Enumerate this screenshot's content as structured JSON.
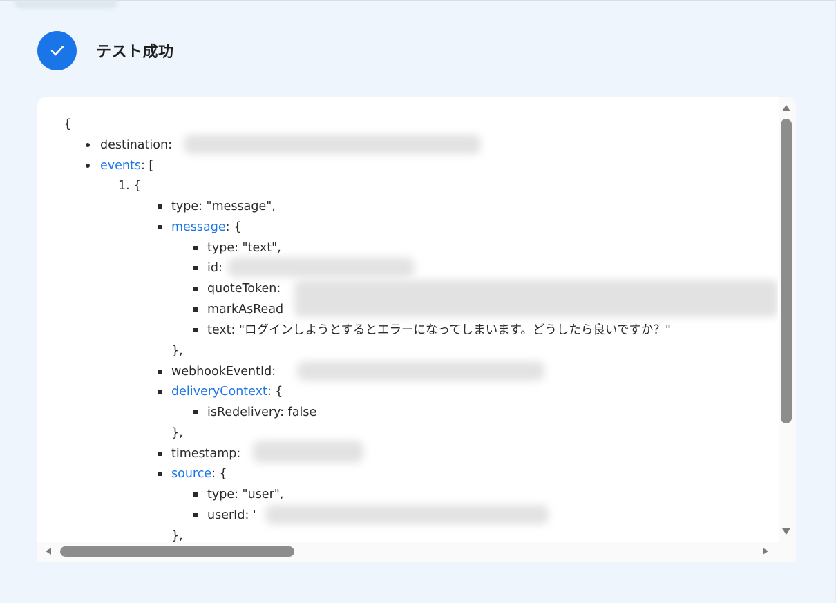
{
  "status": {
    "title": "テスト成功",
    "icon": "check-icon",
    "accent": "#1a75e8"
  },
  "json": {
    "open_brace": "{",
    "destination_key": "destination",
    "events_key": "events",
    "events_open": ": [",
    "item_index": "1. {",
    "type_line": "type: \"message\",",
    "message_key": "message",
    "open_obj": ": {",
    "msg_type": "type: \"text\",",
    "msg_id": "id:",
    "quote_token": "quoteToken:",
    "mark_as_read": "markAsRead",
    "msg_text": "text: \"ログインしようとするとエラーになってしまいます。どうしたら良いですか？\"",
    "close_obj": "},",
    "webhook_event_id": "webhookEventId:",
    "delivery_context_key": "deliveryContext",
    "is_redelivery": "isRedelivery: false",
    "timestamp": "timestamp:",
    "source_key": "source",
    "src_type": "type: \"user\",",
    "user_id": "userId:",
    "user_id_fragment": "'"
  }
}
